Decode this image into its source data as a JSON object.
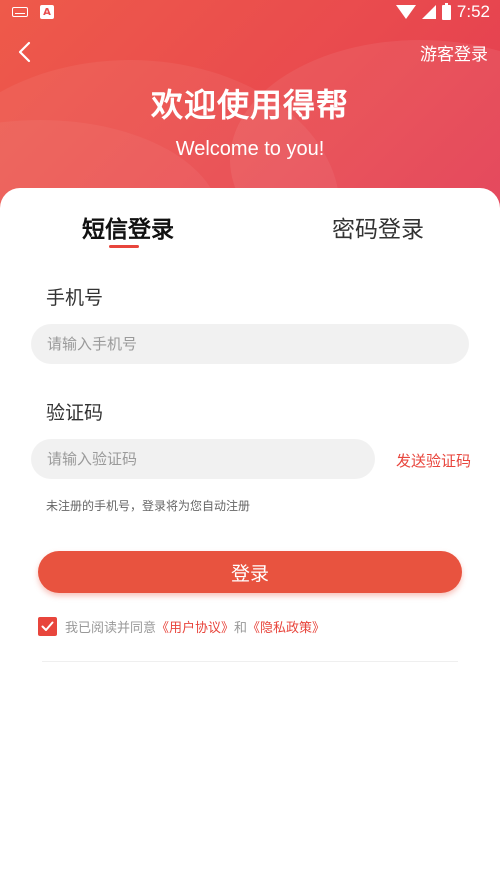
{
  "status_bar": {
    "time": "7:52",
    "icons": [
      "keyboard-icon",
      "app-a-icon",
      "wifi-icon",
      "signal-icon",
      "battery-icon"
    ],
    "app_glyph": "A"
  },
  "header": {
    "guest_login": "游客登录",
    "title": "欢迎使用得帮",
    "subtitle": "Welcome to you!",
    "back_icon": "chevron-left-icon"
  },
  "tabs": [
    {
      "label": "短信登录",
      "active": true
    },
    {
      "label": "密码登录",
      "active": false
    }
  ],
  "form": {
    "phone_label": "手机号",
    "phone_placeholder": "请输入手机号",
    "phone_value": "",
    "code_label": "验证码",
    "code_placeholder": "请输入验证码",
    "code_value": "",
    "send_code": "发送验证码",
    "hint": "未注册的手机号，登录将为您自动注册",
    "login_button": "登录"
  },
  "agreement": {
    "checked": true,
    "prefix": "我已阅读并同意",
    "user_agreement": "《用户协议》",
    "and": "和",
    "privacy_policy": "《隐私政策》"
  },
  "colors": {
    "accent": "#e8453c",
    "header_start": "#ee5a4a",
    "header_end": "#e33b52",
    "input_bg": "#f1f1f1"
  }
}
